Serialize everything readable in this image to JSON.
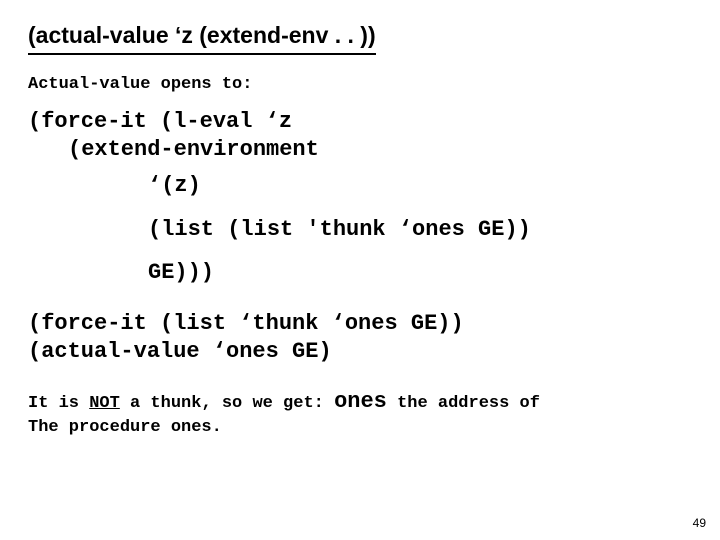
{
  "title": "(actual-value ‘z (extend-env . . ))",
  "line1": "Actual-value opens to:",
  "codeA_l1": "(force-it (l-eval ‘z",
  "codeA_l2": "(extend-environment",
  "codeB": "‘(z)",
  "codeC": "(list (list 'thunk ‘ones GE))",
  "codeD": "GE)))",
  "codeE_l1": "(force-it (list ‘thunk ‘ones GE))",
  "codeE_l2": "(actual-value  ‘ones GE)",
  "summary_pre": "It is ",
  "summary_not": "NOT",
  "summary_mid": " a thunk, so we get: ",
  "summary_ones": "ones",
  "summary_post1": " the address of",
  "summary_post2": "The procedure ones.",
  "pagenum": "49"
}
